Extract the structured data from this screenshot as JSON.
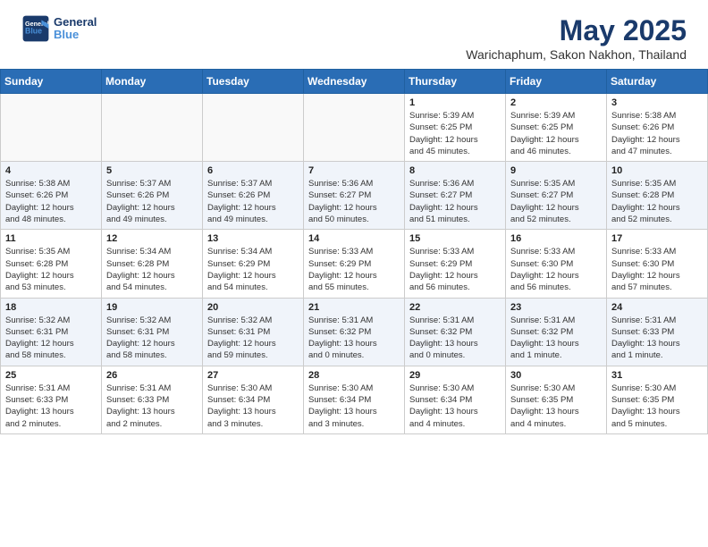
{
  "header": {
    "logo_line1": "General",
    "logo_line2": "Blue",
    "month": "May 2025",
    "location": "Warichaphum, Sakon Nakhon, Thailand"
  },
  "days_of_week": [
    "Sunday",
    "Monday",
    "Tuesday",
    "Wednesday",
    "Thursday",
    "Friday",
    "Saturday"
  ],
  "weeks": [
    [
      {
        "day": "",
        "info": ""
      },
      {
        "day": "",
        "info": ""
      },
      {
        "day": "",
        "info": ""
      },
      {
        "day": "",
        "info": ""
      },
      {
        "day": "1",
        "info": "Sunrise: 5:39 AM\nSunset: 6:25 PM\nDaylight: 12 hours\nand 45 minutes."
      },
      {
        "day": "2",
        "info": "Sunrise: 5:39 AM\nSunset: 6:25 PM\nDaylight: 12 hours\nand 46 minutes."
      },
      {
        "day": "3",
        "info": "Sunrise: 5:38 AM\nSunset: 6:26 PM\nDaylight: 12 hours\nand 47 minutes."
      }
    ],
    [
      {
        "day": "4",
        "info": "Sunrise: 5:38 AM\nSunset: 6:26 PM\nDaylight: 12 hours\nand 48 minutes."
      },
      {
        "day": "5",
        "info": "Sunrise: 5:37 AM\nSunset: 6:26 PM\nDaylight: 12 hours\nand 49 minutes."
      },
      {
        "day": "6",
        "info": "Sunrise: 5:37 AM\nSunset: 6:26 PM\nDaylight: 12 hours\nand 49 minutes."
      },
      {
        "day": "7",
        "info": "Sunrise: 5:36 AM\nSunset: 6:27 PM\nDaylight: 12 hours\nand 50 minutes."
      },
      {
        "day": "8",
        "info": "Sunrise: 5:36 AM\nSunset: 6:27 PM\nDaylight: 12 hours\nand 51 minutes."
      },
      {
        "day": "9",
        "info": "Sunrise: 5:35 AM\nSunset: 6:27 PM\nDaylight: 12 hours\nand 52 minutes."
      },
      {
        "day": "10",
        "info": "Sunrise: 5:35 AM\nSunset: 6:28 PM\nDaylight: 12 hours\nand 52 minutes."
      }
    ],
    [
      {
        "day": "11",
        "info": "Sunrise: 5:35 AM\nSunset: 6:28 PM\nDaylight: 12 hours\nand 53 minutes."
      },
      {
        "day": "12",
        "info": "Sunrise: 5:34 AM\nSunset: 6:28 PM\nDaylight: 12 hours\nand 54 minutes."
      },
      {
        "day": "13",
        "info": "Sunrise: 5:34 AM\nSunset: 6:29 PM\nDaylight: 12 hours\nand 54 minutes."
      },
      {
        "day": "14",
        "info": "Sunrise: 5:33 AM\nSunset: 6:29 PM\nDaylight: 12 hours\nand 55 minutes."
      },
      {
        "day": "15",
        "info": "Sunrise: 5:33 AM\nSunset: 6:29 PM\nDaylight: 12 hours\nand 56 minutes."
      },
      {
        "day": "16",
        "info": "Sunrise: 5:33 AM\nSunset: 6:30 PM\nDaylight: 12 hours\nand 56 minutes."
      },
      {
        "day": "17",
        "info": "Sunrise: 5:33 AM\nSunset: 6:30 PM\nDaylight: 12 hours\nand 57 minutes."
      }
    ],
    [
      {
        "day": "18",
        "info": "Sunrise: 5:32 AM\nSunset: 6:31 PM\nDaylight: 12 hours\nand 58 minutes."
      },
      {
        "day": "19",
        "info": "Sunrise: 5:32 AM\nSunset: 6:31 PM\nDaylight: 12 hours\nand 58 minutes."
      },
      {
        "day": "20",
        "info": "Sunrise: 5:32 AM\nSunset: 6:31 PM\nDaylight: 12 hours\nand 59 minutes."
      },
      {
        "day": "21",
        "info": "Sunrise: 5:31 AM\nSunset: 6:32 PM\nDaylight: 13 hours\nand 0 minutes."
      },
      {
        "day": "22",
        "info": "Sunrise: 5:31 AM\nSunset: 6:32 PM\nDaylight: 13 hours\nand 0 minutes."
      },
      {
        "day": "23",
        "info": "Sunrise: 5:31 AM\nSunset: 6:32 PM\nDaylight: 13 hours\nand 1 minute."
      },
      {
        "day": "24",
        "info": "Sunrise: 5:31 AM\nSunset: 6:33 PM\nDaylight: 13 hours\nand 1 minute."
      }
    ],
    [
      {
        "day": "25",
        "info": "Sunrise: 5:31 AM\nSunset: 6:33 PM\nDaylight: 13 hours\nand 2 minutes."
      },
      {
        "day": "26",
        "info": "Sunrise: 5:31 AM\nSunset: 6:33 PM\nDaylight: 13 hours\nand 2 minutes."
      },
      {
        "day": "27",
        "info": "Sunrise: 5:30 AM\nSunset: 6:34 PM\nDaylight: 13 hours\nand 3 minutes."
      },
      {
        "day": "28",
        "info": "Sunrise: 5:30 AM\nSunset: 6:34 PM\nDaylight: 13 hours\nand 3 minutes."
      },
      {
        "day": "29",
        "info": "Sunrise: 5:30 AM\nSunset: 6:34 PM\nDaylight: 13 hours\nand 4 minutes."
      },
      {
        "day": "30",
        "info": "Sunrise: 5:30 AM\nSunset: 6:35 PM\nDaylight: 13 hours\nand 4 minutes."
      },
      {
        "day": "31",
        "info": "Sunrise: 5:30 AM\nSunset: 6:35 PM\nDaylight: 13 hours\nand 5 minutes."
      }
    ]
  ]
}
